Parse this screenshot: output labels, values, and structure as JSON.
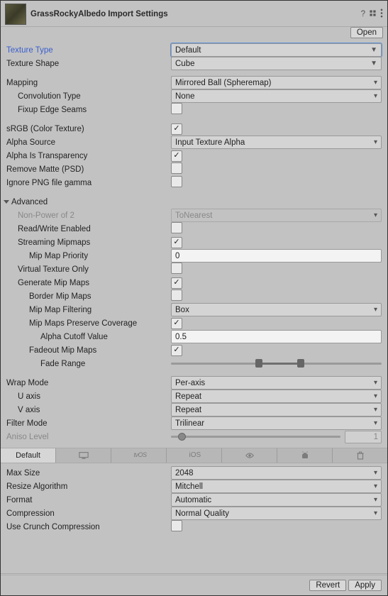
{
  "title": "GrassRockyAlbedo Import Settings",
  "open_label": "Open",
  "texture_type": {
    "label": "Texture Type",
    "value": "Default"
  },
  "texture_shape": {
    "label": "Texture Shape",
    "value": "Cube"
  },
  "mapping": {
    "label": "Mapping",
    "value": "Mirrored Ball (Spheremap)"
  },
  "convolution": {
    "label": "Convolution Type",
    "value": "None"
  },
  "fixup": {
    "label": "Fixup Edge Seams",
    "value": false
  },
  "srgb": {
    "label": "sRGB (Color Texture)",
    "value": true
  },
  "alpha_source": {
    "label": "Alpha Source",
    "value": "Input Texture Alpha"
  },
  "alpha_transparency": {
    "label": "Alpha Is Transparency",
    "value": true
  },
  "remove_matte": {
    "label": "Remove Matte (PSD)",
    "value": false
  },
  "ignore_png": {
    "label": "Ignore PNG file gamma",
    "value": false
  },
  "advanced": {
    "label": "Advanced",
    "np2": {
      "label": "Non-Power of 2",
      "value": "ToNearest"
    },
    "rw": {
      "label": "Read/Write Enabled",
      "value": false
    },
    "streaming": {
      "label": "Streaming Mipmaps",
      "value": true
    },
    "mip_priority": {
      "label": "Mip Map Priority",
      "value": "0"
    },
    "vt_only": {
      "label": "Virtual Texture Only",
      "value": false
    },
    "gen_mips": {
      "label": "Generate Mip Maps",
      "value": true
    },
    "border_mips": {
      "label": "Border Mip Maps",
      "value": false
    },
    "mip_filter": {
      "label": "Mip Map Filtering",
      "value": "Box"
    },
    "preserve_cov": {
      "label": "Mip Maps Preserve Coverage",
      "value": true
    },
    "alpha_cutoff": {
      "label": "Alpha Cutoff Value",
      "value": "0.5"
    },
    "fadeout": {
      "label": "Fadeout Mip Maps",
      "value": true
    },
    "fade_range": {
      "label": "Fade Range"
    }
  },
  "wrap_mode": {
    "label": "Wrap Mode",
    "value": "Per-axis"
  },
  "u_axis": {
    "label": "U axis",
    "value": "Repeat"
  },
  "v_axis": {
    "label": "V axis",
    "value": "Repeat"
  },
  "filter_mode": {
    "label": "Filter Mode",
    "value": "Trilinear"
  },
  "aniso": {
    "label": "Aniso Level",
    "value": "1"
  },
  "tabs": {
    "default": "Default"
  },
  "max_size": {
    "label": "Max Size",
    "value": "2048"
  },
  "resize_algo": {
    "label": "Resize Algorithm",
    "value": "Mitchell"
  },
  "format": {
    "label": "Format",
    "value": "Automatic"
  },
  "compression": {
    "label": "Compression",
    "value": "Normal Quality"
  },
  "crunch": {
    "label": "Use Crunch Compression",
    "value": false
  },
  "footer": {
    "revert": "Revert",
    "apply": "Apply"
  }
}
